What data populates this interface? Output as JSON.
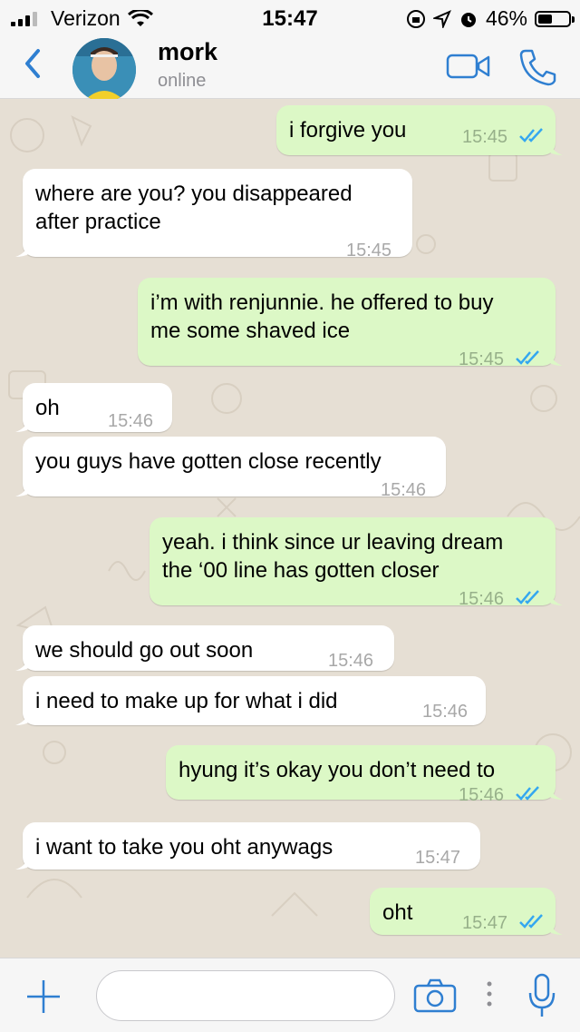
{
  "status": {
    "carrier": "Verizon",
    "time": "15:47",
    "battery": "46%",
    "battery_level": 0.46
  },
  "contact": {
    "name": "mork",
    "presence": "online"
  },
  "messages": [
    {
      "dir": "out",
      "text": [
        "i forgive you"
      ],
      "time": "15:45",
      "read": true
    },
    {
      "dir": "in",
      "text": [
        "where are you? you disappeared",
        "after practice"
      ],
      "time": "15:45"
    },
    {
      "dir": "out",
      "text": [
        "i’m with renjunnie. he offered to buy",
        "me some shaved ice"
      ],
      "time": "15:45",
      "read": true
    },
    {
      "dir": "in",
      "text": [
        "oh"
      ],
      "time": "15:46"
    },
    {
      "dir": "in",
      "text": [
        "you guys have gotten close recently"
      ],
      "time": "15:46"
    },
    {
      "dir": "out",
      "text": [
        "yeah. i think since ur leaving dream",
        "the ‘00 line has gotten closer"
      ],
      "time": "15:46",
      "read": true
    },
    {
      "dir": "in",
      "text": [
        "we should go out soon"
      ],
      "time": "15:46"
    },
    {
      "dir": "in",
      "text": [
        "i need to make up for what i did"
      ],
      "time": "15:46"
    },
    {
      "dir": "out",
      "text": [
        "hyung it’s okay you don’t need to"
      ],
      "time": "15:46",
      "read": true
    },
    {
      "dir": "in",
      "text": [
        "i want to take you oht anywags"
      ],
      "time": "15:47"
    },
    {
      "dir": "out",
      "text": [
        "oht"
      ],
      "time": "15:47",
      "read": true
    }
  ],
  "composer": {
    "placeholder": ""
  },
  "colors": {
    "accent": "#2f7fd1",
    "outgoing": "#dcf8c6",
    "incoming": "#ffffff",
    "wallpaper": "#e6dfd4",
    "read_ticks": "#34a7f0"
  }
}
